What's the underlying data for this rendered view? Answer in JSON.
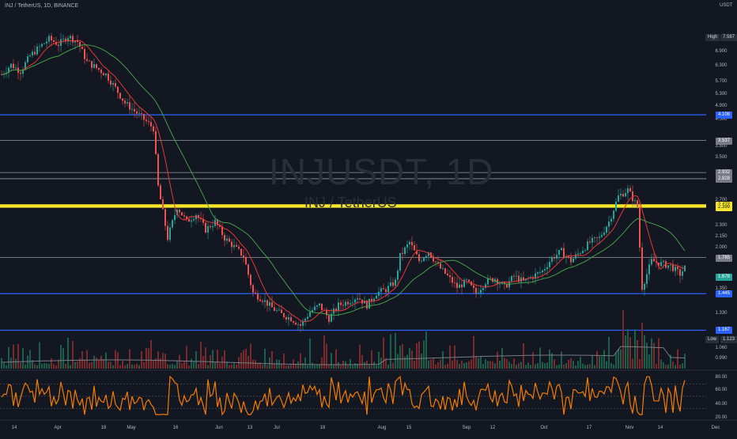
{
  "header": {
    "symbol_line": "INJ / TetherUS, 1D, BINANCE",
    "currency": "USDT"
  },
  "watermark": {
    "symbol": "INJUSDT, 1D",
    "name": "INJ / TetherUS"
  },
  "price_axis": {
    "ticks": [
      "6.900",
      "6.300",
      "5.700",
      "5.300",
      "4.900",
      "4.500",
      "3.800",
      "3.500",
      "3.200",
      "2.700",
      "2.300",
      "2.150",
      "2.000",
      "1.850",
      "1.350",
      "1.330",
      "1.060",
      "0.990"
    ],
    "high_label": "High",
    "high_value": "7.587",
    "low_label": "Low",
    "low_value": "1.123"
  },
  "horizontal_levels": [
    {
      "value": "4.108",
      "color": "#2962ff",
      "kind": "blue"
    },
    {
      "value": "3.537",
      "color": "#9598a1",
      "kind": "gray"
    },
    {
      "value": "2.932",
      "color": "#9598a1",
      "kind": "gray"
    },
    {
      "value": "2.828",
      "color": "#9598a1",
      "kind": "gray"
    },
    {
      "value": "2.423",
      "color": "#f5e62b",
      "kind": "yellow"
    },
    {
      "value": "2.399",
      "color": "#f5e62b",
      "kind": "yellow"
    },
    {
      "value": "1.785",
      "color": "#9598a1",
      "kind": "gray"
    },
    {
      "value": "1.445",
      "color": "#2962ff",
      "kind": "blue"
    },
    {
      "value": "1.167",
      "color": "#2962ff",
      "kind": "blue"
    }
  ],
  "last_price": {
    "value": "1.678",
    "color": "#26a69a"
  },
  "rsi_axis": {
    "ticks": [
      "80.00",
      "60.00",
      "40.00",
      "20.00"
    ]
  },
  "time_axis": {
    "labels": [
      "14",
      "Apr",
      "18",
      "May",
      "16",
      "Jun",
      "13",
      "Jul",
      "18",
      "Aug",
      "15",
      "Sep",
      "12",
      "Oct",
      "17",
      "Nov",
      "14",
      "Dec"
    ]
  },
  "colors": {
    "background": "#131722",
    "up": "#26a69a",
    "down": "#ef5350",
    "ma_fast": "#e53935",
    "ma_slow": "#43a047",
    "rsi": "#f57c00",
    "volume_ma": "#787b86"
  },
  "chart_data": {
    "type": "candlestick",
    "ylim": [
      0.95,
      7.6
    ],
    "scale": "log",
    "close_path": [
      {
        "t": 0,
        "p": 5.2
      },
      {
        "t": 4,
        "p": 5.5
      },
      {
        "t": 8,
        "p": 5.3
      },
      {
        "t": 12,
        "p": 5.8
      },
      {
        "t": 16,
        "p": 6.1
      },
      {
        "t": 20,
        "p": 6.4
      },
      {
        "t": 24,
        "p": 6.2
      },
      {
        "t": 28,
        "p": 6.5
      },
      {
        "t": 32,
        "p": 6.3
      },
      {
        "t": 36,
        "p": 5.6
      },
      {
        "t": 40,
        "p": 5.4
      },
      {
        "t": 44,
        "p": 5.2
      },
      {
        "t": 48,
        "p": 4.8
      },
      {
        "t": 52,
        "p": 4.4
      },
      {
        "t": 56,
        "p": 4.2
      },
      {
        "t": 60,
        "p": 4.0
      },
      {
        "t": 64,
        "p": 3.8
      },
      {
        "t": 66,
        "p": 2.7
      },
      {
        "t": 70,
        "p": 2.0
      },
      {
        "t": 74,
        "p": 2.4
      },
      {
        "t": 78,
        "p": 2.2
      },
      {
        "t": 82,
        "p": 2.3
      },
      {
        "t": 86,
        "p": 2.1
      },
      {
        "t": 90,
        "p": 2.2
      },
      {
        "t": 94,
        "p": 2.0
      },
      {
        "t": 98,
        "p": 1.9
      },
      {
        "t": 102,
        "p": 1.8
      },
      {
        "t": 106,
        "p": 1.45
      },
      {
        "t": 110,
        "p": 1.4
      },
      {
        "t": 114,
        "p": 1.33
      },
      {
        "t": 118,
        "p": 1.28
      },
      {
        "t": 122,
        "p": 1.25
      },
      {
        "t": 126,
        "p": 1.2
      },
      {
        "t": 130,
        "p": 1.3
      },
      {
        "t": 134,
        "p": 1.35
      },
      {
        "t": 138,
        "p": 1.25
      },
      {
        "t": 142,
        "p": 1.35
      },
      {
        "t": 146,
        "p": 1.38
      },
      {
        "t": 150,
        "p": 1.42
      },
      {
        "t": 154,
        "p": 1.35
      },
      {
        "t": 158,
        "p": 1.45
      },
      {
        "t": 162,
        "p": 1.48
      },
      {
        "t": 166,
        "p": 1.55
      },
      {
        "t": 168,
        "p": 1.8
      },
      {
        "t": 172,
        "p": 1.95
      },
      {
        "t": 176,
        "p": 1.75
      },
      {
        "t": 180,
        "p": 1.85
      },
      {
        "t": 184,
        "p": 1.7
      },
      {
        "t": 188,
        "p": 1.6
      },
      {
        "t": 192,
        "p": 1.5
      },
      {
        "t": 196,
        "p": 1.55
      },
      {
        "t": 200,
        "p": 1.45
      },
      {
        "t": 204,
        "p": 1.55
      },
      {
        "t": 208,
        "p": 1.58
      },
      {
        "t": 212,
        "p": 1.5
      },
      {
        "t": 216,
        "p": 1.6
      },
      {
        "t": 220,
        "p": 1.55
      },
      {
        "t": 224,
        "p": 1.6
      },
      {
        "t": 228,
        "p": 1.65
      },
      {
        "t": 232,
        "p": 1.78
      },
      {
        "t": 236,
        "p": 1.85
      },
      {
        "t": 240,
        "p": 1.75
      },
      {
        "t": 244,
        "p": 1.85
      },
      {
        "t": 248,
        "p": 1.95
      },
      {
        "t": 252,
        "p": 2.0
      },
      {
        "t": 256,
        "p": 2.2
      },
      {
        "t": 260,
        "p": 2.55
      },
      {
        "t": 264,
        "p": 2.65
      },
      {
        "t": 268,
        "p": 2.4
      },
      {
        "t": 270,
        "p": 1.5
      },
      {
        "t": 274,
        "p": 1.75
      },
      {
        "t": 278,
        "p": 1.72
      },
      {
        "t": 282,
        "p": 1.7
      },
      {
        "t": 286,
        "p": 1.62
      },
      {
        "t": 288,
        "p": 1.68
      }
    ]
  }
}
